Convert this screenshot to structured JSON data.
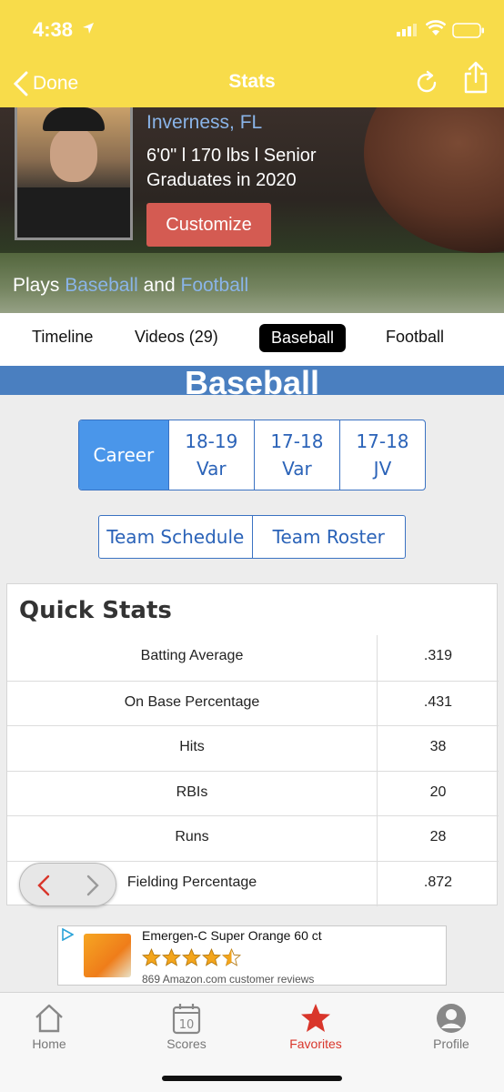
{
  "status_bar": {
    "time": "4:38",
    "icons": [
      "location-arrow-icon",
      "signal-icon",
      "wifi-icon",
      "battery-icon"
    ]
  },
  "nav": {
    "back_label": "Done",
    "title": "Stats",
    "icons": [
      "refresh-icon",
      "share-icon"
    ]
  },
  "profile": {
    "location": "Inverness, FL",
    "measurements": "6'0\" l 170 lbs l Senior",
    "graduation": "Graduates in 2020",
    "customize_label": "Customize",
    "plays_prefix": "Plays",
    "plays_conjunction": "and",
    "sports": [
      "Baseball",
      "Football"
    ]
  },
  "tabs": [
    {
      "label": "Timeline",
      "active": false
    },
    {
      "label": "Videos (29)",
      "active": false
    },
    {
      "label": "Baseball",
      "active": true
    },
    {
      "label": "Football",
      "active": false
    }
  ],
  "section_title": "Baseball",
  "seasons": [
    {
      "line1": "Career",
      "line2": "",
      "active": true
    },
    {
      "line1": "18-19",
      "line2": "Var",
      "active": false
    },
    {
      "line1": "17-18",
      "line2": "Var",
      "active": false
    },
    {
      "line1": "17-18",
      "line2": "JV",
      "active": false
    }
  ],
  "team_buttons": [
    "Team Schedule",
    "Team Roster"
  ],
  "quick_stats": {
    "title": "Quick Stats",
    "rows": [
      {
        "label": "Batting Average",
        "value": ".319"
      },
      {
        "label": "On Base Percentage",
        "value": ".431"
      },
      {
        "label": "Hits",
        "value": "38"
      },
      {
        "label": "RBIs",
        "value": "20"
      },
      {
        "label": "Runs",
        "value": "28"
      },
      {
        "label": "Fielding Percentage",
        "value": ".872"
      }
    ]
  },
  "ad": {
    "title": "Emergen-C Super Orange 60 ct",
    "rating": 4.5,
    "reviews": "869 Amazon.com customer reviews"
  },
  "tab_bar": [
    {
      "label": "Home",
      "icon": "home-icon",
      "active": false
    },
    {
      "label": "Scores",
      "icon": "calendar-icon",
      "active": false
    },
    {
      "label": "Favorites",
      "icon": "star-icon",
      "active": true
    },
    {
      "label": "Profile",
      "icon": "person-icon",
      "active": false
    }
  ],
  "colors": {
    "header_yellow": "#f8dc4a",
    "link_blue": "#2b63b8",
    "section_blue": "#4a7fc0",
    "active_red": "#d9362b",
    "customize_red": "#d45b52"
  }
}
